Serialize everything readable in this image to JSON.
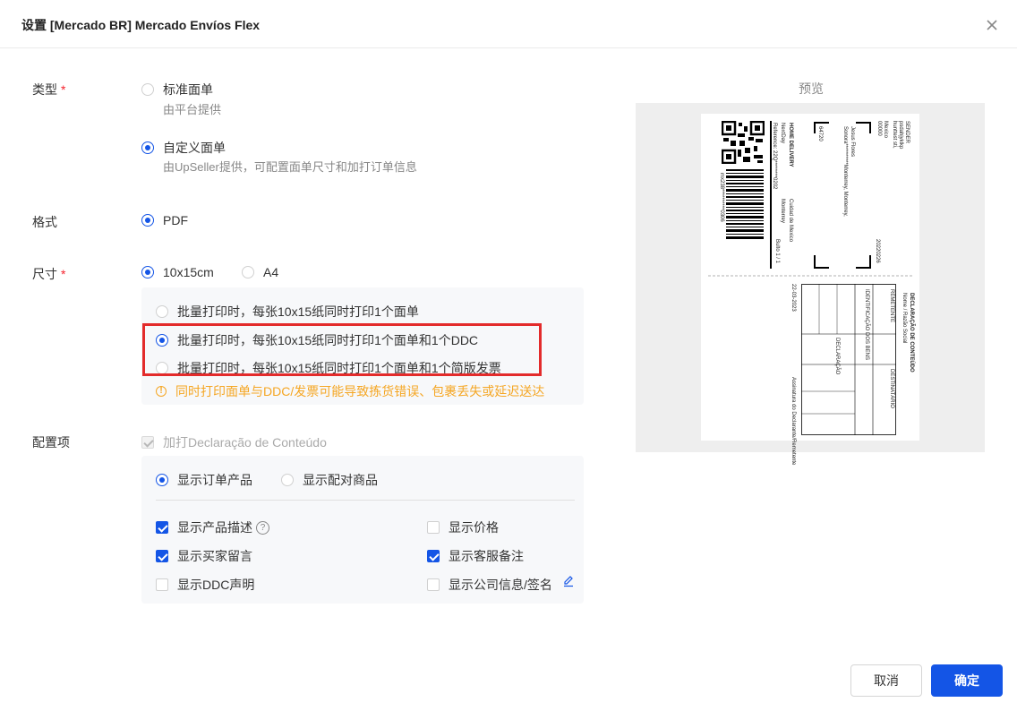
{
  "dialog": {
    "title": "设置 [Mercado BR] Mercado Envíos Flex"
  },
  "type_section": {
    "label": "类型",
    "required_mark": "*",
    "options": [
      {
        "label": "标准面单",
        "desc": "由平台提供",
        "selected": false
      },
      {
        "label": "自定义面单",
        "desc": "由UpSeller提供，可配置面单尺寸和加打订单信息",
        "selected": true
      }
    ]
  },
  "format_section": {
    "label": "格式",
    "options": [
      {
        "label": "PDF",
        "selected": true
      }
    ]
  },
  "size_section": {
    "label": "尺寸",
    "required_mark": "*",
    "options": [
      {
        "label": "10x15cm",
        "selected": true
      },
      {
        "label": "A4",
        "selected": false
      }
    ],
    "batch_options": [
      {
        "label": "批量打印时，每张10x15纸同时打印1个面单",
        "selected": false
      },
      {
        "label": "批量打印时，每张10x15纸同时打印1个面单和1个DDC",
        "selected": true
      },
      {
        "label": "批量打印时，每张10x15纸同时打印1个面单和1个简版发票",
        "selected": false
      }
    ],
    "warning": "同时打印面单与DDC/发票可能导致拣货错误、包裹丢失或延迟送达"
  },
  "config_section": {
    "label": "配置项",
    "declaration_label": "加打Declaração de Conteúdo",
    "display_modes": [
      {
        "label": "显示订单产品",
        "selected": true
      },
      {
        "label": "显示配对商品",
        "selected": false
      }
    ],
    "checkboxes": [
      {
        "label": "显示产品描述",
        "checked": true
      },
      {
        "label": "显示价格",
        "checked": false
      },
      {
        "label": "显示买家留言",
        "checked": true
      },
      {
        "label": "显示客服备注",
        "checked": true
      },
      {
        "label": "显示DDC声明",
        "checked": false
      },
      {
        "label": "显示公司信息/签名",
        "checked": false
      }
    ]
  },
  "preview": {
    "title": "预览",
    "label_texts": {
      "delivery": "HOME DELIVERY",
      "service": "NextDay",
      "reference": "Reference: 22Q********0202",
      "city": "Cuidad de Mexico",
      "city2": "Monterrey",
      "bulto": "Bulto 1 / 1",
      "zip": "64720",
      "recipient": "Jesus Flores",
      "address": "Sonora**********Monterrey, Monterrey,",
      "date": "20220226",
      "barcode_text": "mx238**********0306",
      "sender1": "SENDER",
      "sender2": "psdahjyklkp",
      "sender3": "hunttest sti,",
      "sender4": "Mexico",
      "sender5": "00000",
      "ddc_title": "DECLARAÇÃO DE CONTEÚDO",
      "ddc_sub": "Nome / Razão Social",
      "ddc_sender": "REMETENTE",
      "ddc_receiver": "DESTINATÁRIO",
      "ddc_id": "IDENTIFICAÇÃO DOS BENS",
      "ddc_decl": "DECLARAÇÃO",
      "ddc_footer": "Assinatura do Declarante/Remetente",
      "ddc_date": "22-03-2023"
    }
  },
  "footer": {
    "cancel": "取消",
    "confirm": "确定"
  },
  "colors": {
    "primary": "#1455e6",
    "required": "#f5222d",
    "warning": "#f5a623",
    "highlight_border": "#e32b2b"
  }
}
